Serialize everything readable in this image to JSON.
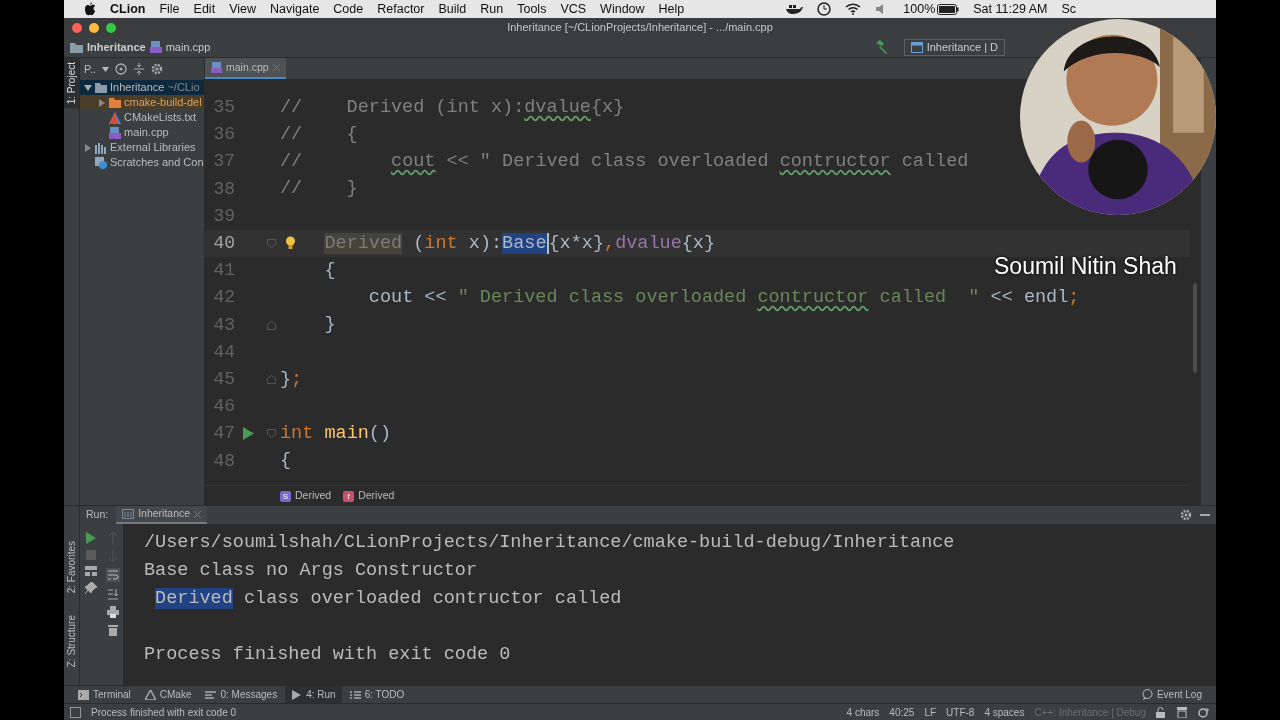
{
  "menubar": {
    "app": "CLion",
    "menus": [
      "File",
      "Edit",
      "View",
      "Navigate",
      "Code",
      "Refactor",
      "Build",
      "Run",
      "Tools",
      "VCS",
      "Window",
      "Help"
    ],
    "battery": "100%",
    "clock": "Sat 11:29 AM",
    "user": "Sc"
  },
  "window": {
    "title": "Inheritance [~/CLionProjects/Inheritance] - .../main.cpp"
  },
  "navbar": {
    "crumbs": [
      "Inheritance",
      "main.cpp"
    ],
    "run_config": "Inheritance | D"
  },
  "left_strip": {
    "top": [
      {
        "label": "1: Project",
        "selected": true
      }
    ],
    "bottom": [
      {
        "label": "2: Favorites",
        "selected": false
      },
      {
        "label": "Z: Structure",
        "selected": false
      }
    ]
  },
  "project": {
    "view": "P..",
    "tree": [
      {
        "name": "Inheritance",
        "path": "~/CLio",
        "kind": "folder",
        "expanded": true,
        "selected": true,
        "children": [
          {
            "name": "cmake-build-del",
            "kind": "excluded",
            "expanded": false,
            "selected": false
          },
          {
            "name": "CMakeLists.txt",
            "kind": "cmake",
            "selected": false
          },
          {
            "name": "main.cpp",
            "kind": "cpp",
            "selected": false
          }
        ]
      },
      {
        "name": "External Libraries",
        "kind": "libraries",
        "expanded": false,
        "selected": false
      },
      {
        "name": "Scratches and Con",
        "kind": "scratches",
        "selected": false
      }
    ]
  },
  "editor": {
    "tabs": [
      {
        "label": "main.cpp",
        "selected": true
      }
    ],
    "lines": [
      {
        "number": "35",
        "current": false,
        "tokens": [
          {
            "text": "//    Derived (int x):",
            "kind": "comment"
          },
          {
            "text": "dvalue",
            "kind": "comment_typo"
          },
          {
            "text": "{x}",
            "kind": "comment"
          }
        ]
      },
      {
        "number": "36",
        "current": false,
        "tokens": [
          {
            "text": "//    {",
            "kind": "comment"
          }
        ]
      },
      {
        "number": "37",
        "current": false,
        "tokens": [
          {
            "text": "//        ",
            "kind": "comment"
          },
          {
            "text": "cout",
            "kind": "comment_typo"
          },
          {
            "text": " << \" Derived class overloaded ",
            "kind": "comment"
          },
          {
            "text": "contructor",
            "kind": "comment_typo"
          },
          {
            "text": " called",
            "kind": "comment"
          }
        ]
      },
      {
        "number": "38",
        "current": false,
        "tokens": [
          {
            "text": "//    }",
            "kind": "comment"
          }
        ]
      },
      {
        "number": "39",
        "current": false
      },
      {
        "number": "40",
        "current": true,
        "gutter": {
          "kind": "bulb"
        },
        "fold": {
          "kind": "start"
        },
        "tokens": [
          {
            "text": "    Derived",
            "kind": "unused"
          },
          {
            "text": " (",
            "kind": "plain"
          },
          {
            "text": "int",
            "kind": "keyword"
          },
          {
            "text": " x):",
            "kind": "plain"
          },
          {
            "text": "Base",
            "kind": "selected"
          },
          {
            "text": "{x*x}",
            "kind": "plain"
          },
          {
            "text": ",",
            "kind": "keyword"
          },
          {
            "text": "dvalue",
            "kind": "field"
          },
          {
            "text": "{x}",
            "kind": "plain"
          }
        ]
      },
      {
        "number": "41",
        "current": false,
        "tokens": [
          {
            "text": "    {",
            "kind": "plain"
          }
        ]
      },
      {
        "number": "42",
        "current": false,
        "tokens": [
          {
            "text": "        cout << ",
            "kind": "plain"
          },
          {
            "text": "\" Derived class overloaded ",
            "kind": "string"
          },
          {
            "text": "contructor",
            "kind": "string_typo"
          },
          {
            "text": " called  \"",
            "kind": "string"
          },
          {
            "text": " << endl",
            "kind": "plain"
          },
          {
            "text": ";",
            "kind": "keyword"
          }
        ]
      },
      {
        "number": "43",
        "current": false,
        "fold": {
          "kind": "end"
        },
        "tokens": [
          {
            "text": "    }",
            "kind": "plain"
          }
        ]
      },
      {
        "number": "44",
        "current": false
      },
      {
        "number": "45",
        "current": false,
        "fold": {
          "kind": "end"
        },
        "tokens": [
          {
            "text": "}",
            "kind": "plain"
          },
          {
            "text": ";",
            "kind": "keyword"
          }
        ]
      },
      {
        "number": "46",
        "current": false
      },
      {
        "number": "47",
        "current": false,
        "gutter": {
          "kind": "run"
        },
        "fold": {
          "kind": "start"
        },
        "tokens": [
          {
            "text": "int",
            "kind": "keyword"
          },
          {
            "text": " main",
            "kind": "func"
          },
          {
            "text": "()",
            "kind": "plain"
          }
        ]
      },
      {
        "number": "48",
        "current": false,
        "tokens": [
          {
            "text": "{",
            "kind": "plain"
          }
        ]
      }
    ],
    "breadcrumbs": [
      {
        "badge": "S",
        "label": "Derived",
        "color": "#7b68c8"
      },
      {
        "badge": "f",
        "label": "Derived",
        "color": "#c7506a"
      }
    ]
  },
  "run": {
    "title": "Run:",
    "tabs": [
      {
        "label": "Inheritance",
        "selected": true
      }
    ],
    "output": [
      {
        "segments": [
          {
            "text": "/Users/soumilshah/CLionProjects/Inheritance/cmake-build-debug/Inheritance",
            "selected": false
          }
        ]
      },
      {
        "segments": [
          {
            "text": "Base class no Args Constructor",
            "selected": false
          }
        ]
      },
      {
        "segments": [
          {
            "text": " Derived",
            "selected": true
          },
          {
            "text": " class overloaded contructor called",
            "selected": false
          }
        ]
      }
    ],
    "exit_message": "Process finished with exit code 0"
  },
  "tool_tabs": [
    {
      "label": "Terminal",
      "kind": "terminal",
      "selected": false
    },
    {
      "label": "CMake",
      "kind": "cmake",
      "selected": false
    },
    {
      "label": "0: Messages",
      "kind": "messages",
      "selected": false
    },
    {
      "label": "4: Run",
      "kind": "run",
      "selected": true
    },
    {
      "label": "6: TODO",
      "kind": "todo",
      "selected": false
    }
  ],
  "event_log": "Event Log",
  "status_bar": {
    "message": "Process finished with exit code 0",
    "items": [
      {
        "text": "4 chars",
        "disabled": false
      },
      {
        "text": "40:25",
        "disabled": false
      },
      {
        "text": "LF",
        "disabled": false
      },
      {
        "text": "UTF-8",
        "disabled": false
      },
      {
        "text": "4 spaces",
        "disabled": false
      },
      {
        "text": "C++: Inheritance | Debug",
        "disabled": true
      }
    ]
  },
  "overlay": {
    "name": "Soumil Nitin Shah"
  }
}
